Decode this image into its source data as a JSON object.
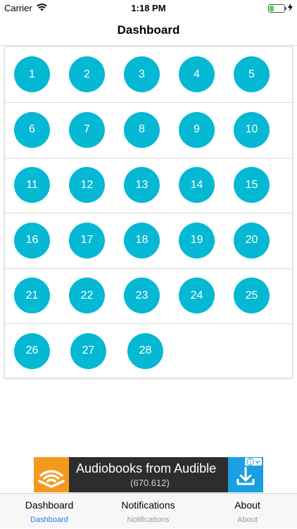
{
  "status_bar": {
    "carrier": "Carrier",
    "time": "1:18 PM",
    "wifi_icon": "wifi-icon",
    "battery_icon": "battery-icon",
    "charging_icon": "charging-bolt-icon"
  },
  "nav": {
    "title": "Dashboard"
  },
  "grid": {
    "accent_color": "#05b8d4",
    "rows": [
      [
        "1",
        "2",
        "3",
        "4",
        "5"
      ],
      [
        "6",
        "7",
        "8",
        "9",
        "10"
      ],
      [
        "11",
        "12",
        "13",
        "14",
        "15"
      ],
      [
        "16",
        "17",
        "18",
        "19",
        "20"
      ],
      [
        "21",
        "22",
        "23",
        "24",
        "25"
      ],
      [
        "26",
        "27",
        "28"
      ]
    ]
  },
  "ad": {
    "title": "Audiobooks from Audible",
    "subtitle": "(670.612)",
    "logo_icon": "audible-logo-icon",
    "download_icon": "download-icon",
    "info_icon": "info-icon",
    "colors": {
      "background": "#2d2d2d",
      "logo": "#f39a1e",
      "download": "#1a9fe0"
    }
  },
  "tabs": [
    {
      "label": "Dashboard",
      "sub": "Dashboard",
      "active": true
    },
    {
      "label": "Notifications",
      "sub": "Notifications",
      "active": false
    },
    {
      "label": "About",
      "sub": "About",
      "active": false
    }
  ],
  "tab_active_color": "#2a7be4"
}
